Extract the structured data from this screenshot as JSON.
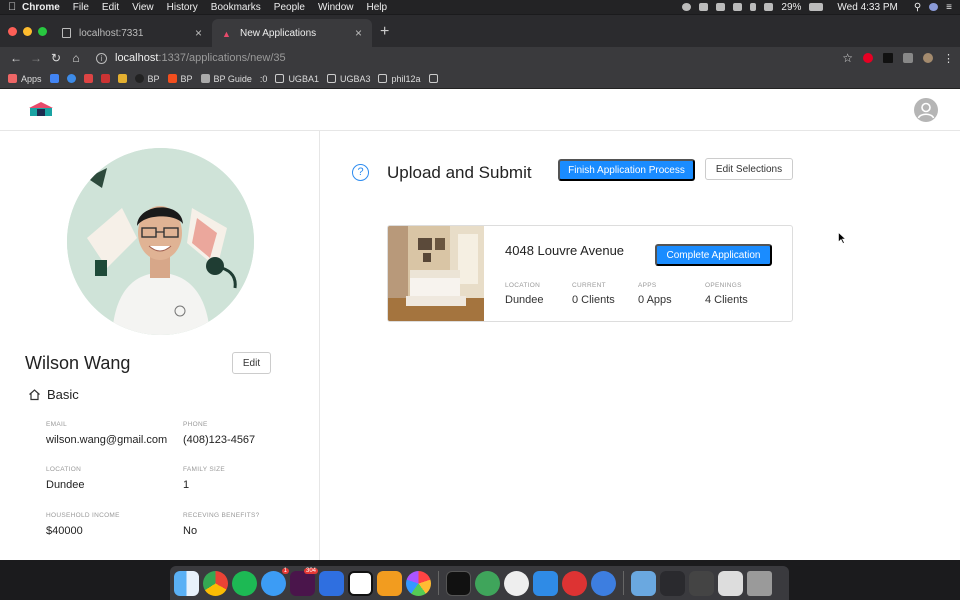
{
  "menubar": {
    "app": "Chrome",
    "items": [
      "File",
      "Edit",
      "View",
      "History",
      "Bookmarks",
      "People",
      "Window",
      "Help"
    ],
    "battery": "29%",
    "clock": "Wed 4:33 PM"
  },
  "browser": {
    "tabs": [
      {
        "title": "localhost:7331"
      },
      {
        "title": "New Applications"
      }
    ],
    "url_host": "localhost",
    "url_path": ":1337/applications/new/35",
    "bookmarks": [
      "Apps",
      "BP",
      "BP",
      "BP Guide",
      ":0",
      "UGBA1",
      "UGBA3",
      "phil12a"
    ]
  },
  "profile": {
    "name": "Wilson Wang",
    "edit_label": "Edit",
    "section_title": "Basic",
    "fields": [
      {
        "label": "EMAIL",
        "value": "wilson.wang@gmail.com"
      },
      {
        "label": "PHONE",
        "value": "(408)123-4567"
      },
      {
        "label": "LOCATION",
        "value": "Dundee"
      },
      {
        "label": "FAMILY SIZE",
        "value": "1"
      },
      {
        "label": "HOUSEHOLD INCOME",
        "value": "$40000"
      },
      {
        "label": "RECEVING BENEFITS?",
        "value": "No"
      }
    ]
  },
  "main": {
    "title": "Upload and Submit",
    "finish_button": "Finish Application Process",
    "edit_selections_button": "Edit Selections",
    "card": {
      "address": "4048 Louvre Avenue",
      "complete_button": "Complete Application",
      "stats": [
        {
          "label": "LOCATION",
          "value": "Dundee"
        },
        {
          "label": "CURRENT",
          "value": "0 Clients"
        },
        {
          "label": "APPS",
          "value": "0 Apps"
        },
        {
          "label": "OPENINGS",
          "value": "4 Clients"
        }
      ]
    }
  },
  "colors": {
    "primary": "#1a8cff",
    "logo_teal": "#1aa3a3",
    "logo_red": "#e84a6b",
    "logo_dark": "#1d2b4f"
  },
  "dock": {
    "messages_badge": "1",
    "slack_badge": "304"
  }
}
